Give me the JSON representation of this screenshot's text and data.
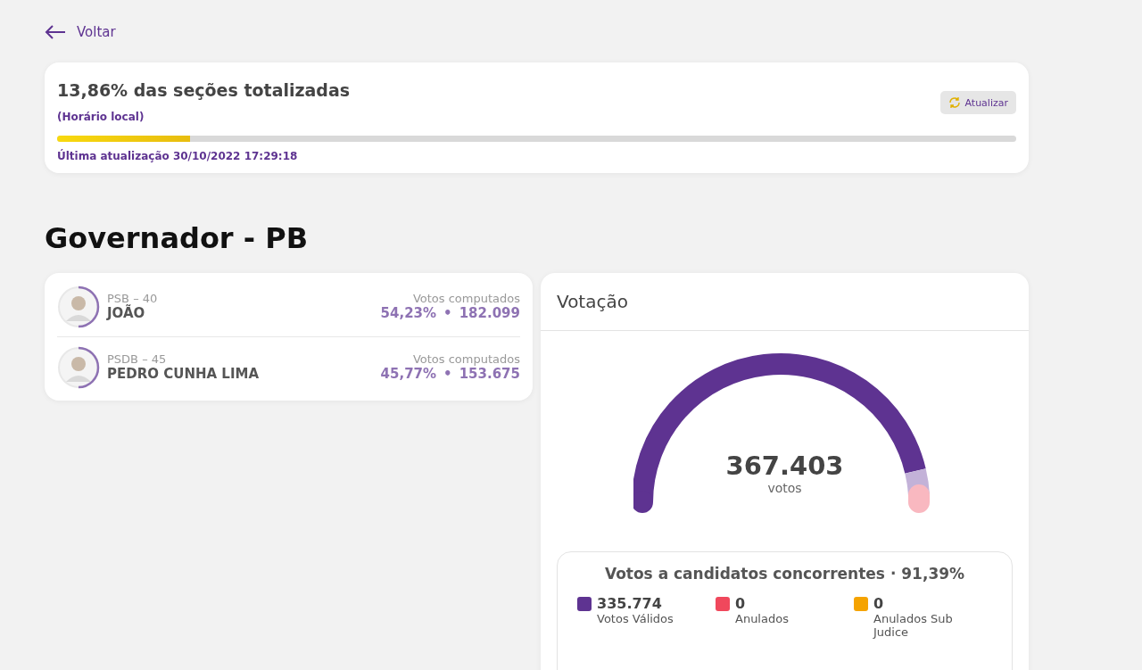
{
  "back_link": {
    "label": "Voltar"
  },
  "progress": {
    "title": "13,86% das seções totalizadas",
    "note": "(Horário local)",
    "refresh_button": "Atualizar",
    "level": 0.1386,
    "last_update": "Última atualização 30/10/2022 17:29:18"
  },
  "office_title": "Governador - PB",
  "candidates": [
    {
      "party": "PSB – 40",
      "name": "JOÃO",
      "votes_label": "Votos computados",
      "percent": "54,23%",
      "separator": "•",
      "votes": "182.099"
    },
    {
      "party": "PSDB – 45",
      "name": "PEDRO CUNHA LIMA",
      "votes_label": "Votos computados",
      "percent": "45,77%",
      "separator": "•",
      "votes": "153.675"
    }
  ],
  "voting": {
    "title": "Votação",
    "total": "367.403",
    "total_label": "votos",
    "summary": {
      "title": "Votos a candidatos concorrentes · 91,39%",
      "items": [
        {
          "value": "335.774",
          "label": "Votos Válidos",
          "color": "#5e3391"
        },
        {
          "value": "0",
          "label": "Anulados",
          "color": "#f0485c"
        },
        {
          "value": "0",
          "label": "Anulados Sub Judice",
          "color": "#f5a300"
        }
      ]
    }
  }
}
